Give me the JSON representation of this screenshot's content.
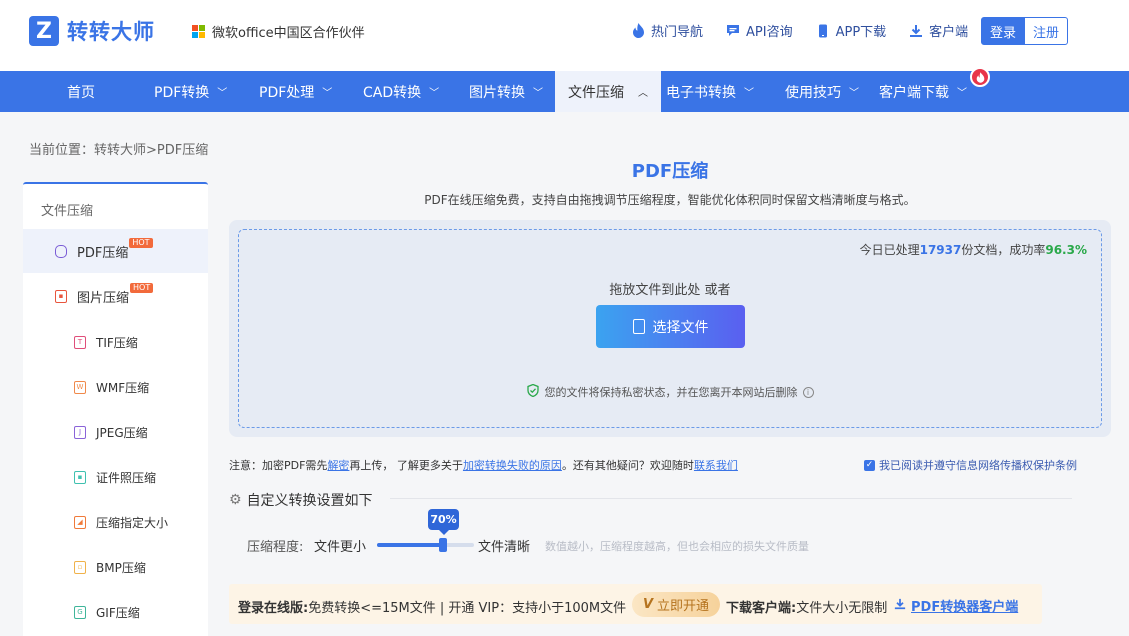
{
  "header": {
    "logo_text": "转转大师",
    "logo_mark": "Z",
    "partner": "微软office中国区合作伙伴",
    "links": [
      {
        "label": "热门导航",
        "icon": "flame-icon"
      },
      {
        "label": "API咨询",
        "icon": "chat-icon"
      },
      {
        "label": "APP下载",
        "icon": "phone-icon"
      },
      {
        "label": "客户端",
        "icon": "download-icon"
      }
    ],
    "login": "登录",
    "register": "注册"
  },
  "nav": {
    "items": [
      {
        "label": "首页"
      },
      {
        "label": "PDF转换"
      },
      {
        "label": "PDF处理"
      },
      {
        "label": "CAD转换"
      },
      {
        "label": "图片转换"
      },
      {
        "label": "文件压缩"
      },
      {
        "label": "电子书转换"
      },
      {
        "label": "使用技巧"
      },
      {
        "label": "客户端下载"
      }
    ],
    "hot_icon": "flame-icon"
  },
  "breadcrumb": "当前位置：转转大师>PDF压缩",
  "sidebar": {
    "title": "文件压缩",
    "items": [
      {
        "label": "PDF压缩",
        "hot": "HOT",
        "color": "#7a5cd6"
      },
      {
        "label": "图片压缩",
        "hot": "HOT",
        "color": "#e8553d"
      },
      {
        "label": "TIF压缩",
        "color": "#e04e7a"
      },
      {
        "label": "WMF压缩",
        "color": "#f0894a"
      },
      {
        "label": "JPEG压缩",
        "color": "#8a63d8"
      },
      {
        "label": "证件照压缩",
        "color": "#3fc1b0"
      },
      {
        "label": "压缩指定大小",
        "color": "#f07a3a"
      },
      {
        "label": "BMP压缩",
        "color": "#f0b24a"
      },
      {
        "label": "GIF压缩",
        "color": "#3fb59a"
      }
    ]
  },
  "main": {
    "title": "PDF压缩",
    "description": "PDF在线压缩免费，支持自由拖拽调节压缩程度，智能优化体积同时保留文档清晰度与格式。",
    "stats": {
      "prefix": "今日已处理",
      "count": "17937",
      "middle": "份文档，成功率",
      "rate": "96.3%"
    },
    "drop_hint": "拖放文件到此处 或者",
    "choose_button": "选择文件",
    "privacy": "您的文件将保持私密状态，并在您离开本网站后删除"
  },
  "notice": {
    "part1": "注意：加密PDF需先",
    "link1": "解密",
    "part2": "再上传，  了解更多关于",
    "link2": "加密转换失败的原因",
    "part3": "。还有其他疑问？欢迎随时",
    "link3": "联系我们"
  },
  "agree": {
    "text": "我已阅读并遵守信息网络传播权保护条例"
  },
  "settings": {
    "title": "自定义转换设置如下",
    "label": "压缩程度:",
    "left": "文件更小",
    "right": "文件清晰",
    "tip": "数值越小，压缩程度越高，但也会相应的损失文件质量",
    "value_label": "70%",
    "value": 0.7
  },
  "promo": {
    "online_label": "登录在线版:",
    "online_text": "免费转换<=15M文件 | 开通 VIP：支持小于100M文件",
    "open_button": "立即开通",
    "open_icon": "V",
    "client_label": "下载客户端:",
    "client_text": "文件大小无限制",
    "client_link": "PDF转换器客户端"
  },
  "colors": {
    "brand": "#3a74e6",
    "success": "#2aa84a",
    "hot": "#f26a3b"
  }
}
